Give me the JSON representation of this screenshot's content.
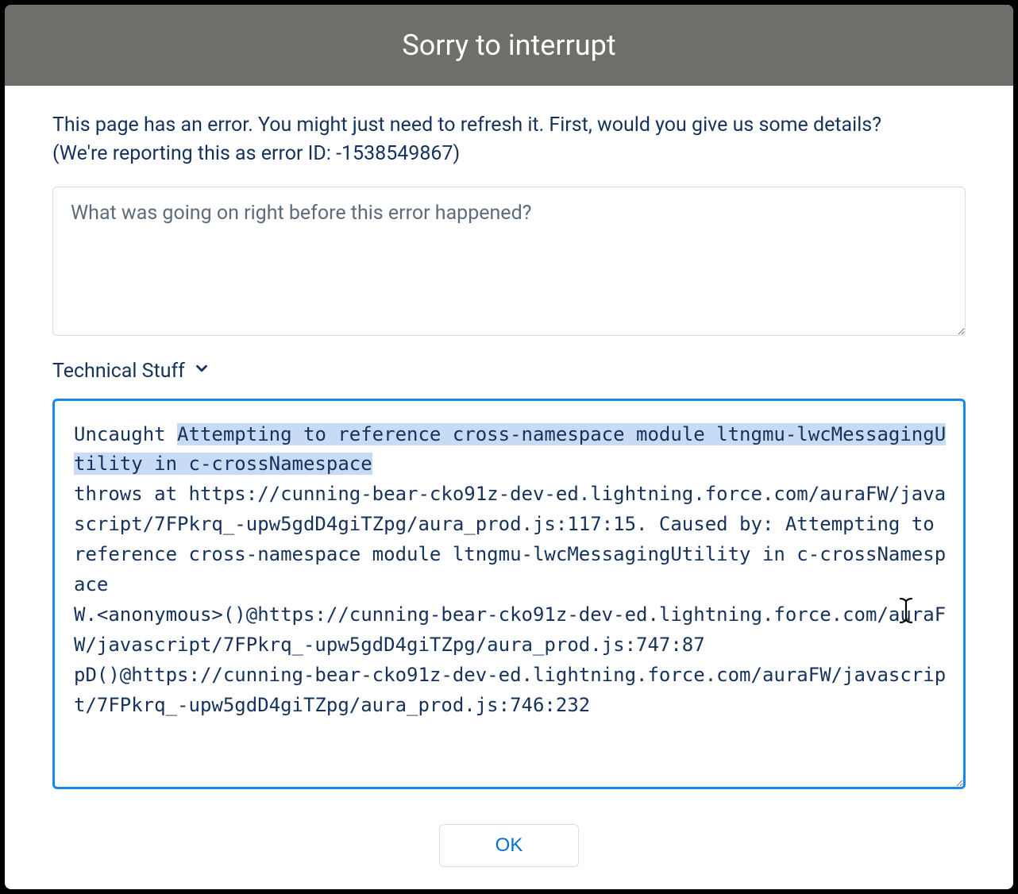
{
  "header": {
    "title": "Sorry to interrupt"
  },
  "prompt": {
    "line1": "This page has an error. You might just need to refresh it. First, would you give us some details?",
    "line2": "(We're reporting this as error ID: -1538549867)"
  },
  "details": {
    "placeholder": "What was going on right before this error happened?",
    "value": ""
  },
  "technical": {
    "toggle_label": "Technical Stuff",
    "expanded": true,
    "stack_prefix": "Uncaught ",
    "stack_highlight": "Attempting to reference cross-namespace module ltngmu-lwcMessagingUtility in c-crossNamespace",
    "stack_rest": "\nthrows at https://cunning-bear-cko91z-dev-ed.lightning.force.com/auraFW/javascript/7FPkrq_-upw5gdD4giTZpg/aura_prod.js:117:15. Caused by: Attempting to reference cross-namespace module ltngmu-lwcMessagingUtility in c-crossNamespace\nW.<anonymous>()@https://cunning-bear-cko91z-dev-ed.lightning.force.com/auraFW/javascript/7FPkrq_-upw5gdD4giTZpg/aura_prod.js:747:87\npD()@https://cunning-bear-cko91z-dev-ed.lightning.force.com/auraFW/javascript/7FPkrq_-upw5gdD4giTZpg/aura_prod.js:746:232"
  },
  "footer": {
    "ok_label": "OK"
  }
}
